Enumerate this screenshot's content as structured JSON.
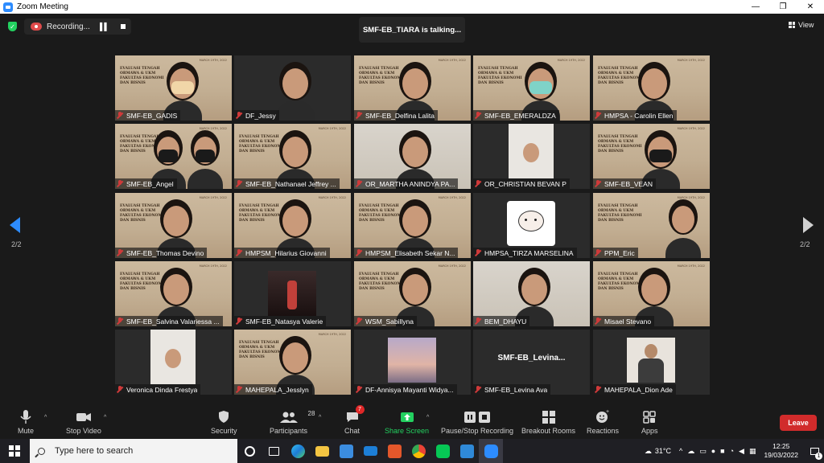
{
  "window": {
    "title": "Zoom Meeting",
    "minimize_glyph": "—",
    "maximize_glyph": "❐",
    "close_glyph": "✕"
  },
  "meeting": {
    "recording_label": "Recording...",
    "talking_indicator": "SMF-EB_TIARA is talking...",
    "view_label": "View",
    "page_left": "2/2",
    "page_right": "2/2",
    "poster_text": "EVALUASI TENGAH ORMAWA & UKM FAKULTAS EKONOMI DAN BISNIS",
    "poster_date": "MARCH 19TH, 2022",
    "participants": [
      {
        "name": "SMF-EB_GADIS"
      },
      {
        "name": "DF_Jessy"
      },
      {
        "name": "SMF-EB_Delfina Lalita"
      },
      {
        "name": "SMF-EB_EMERALDZA"
      },
      {
        "name": "HMPSA - Carolin Ellen"
      },
      {
        "name": "SMF-EB_Angel"
      },
      {
        "name": "SMF-EB_Nathanael Jeffrey ..."
      },
      {
        "name": "OR_MARTHA ANINDYA PA..."
      },
      {
        "name": "OR_CHRISTIAN BEVAN P"
      },
      {
        "name": "SMF-EB_VEAN"
      },
      {
        "name": "SMF-EB_Thomas Devino"
      },
      {
        "name": "HMPSM_Hilarius Giovanni"
      },
      {
        "name": "HMPSM_Elisabeth Sekar N..."
      },
      {
        "name": "HMPSA_TIRZA MARSELINA"
      },
      {
        "name": "PPM_Eric"
      },
      {
        "name": "SMF-EB_Salvina Valariessa ..."
      },
      {
        "name": "SMF-EB_Natasya Valerie"
      },
      {
        "name": "WSM_Sabillyna"
      },
      {
        "name": "BEM_DHAYU"
      },
      {
        "name": "Misael Stevano"
      },
      {
        "name": "Veronica Dinda Frestya"
      },
      {
        "name": "MAHEPALA_Jesslyn"
      },
      {
        "name": "DF-Annisya Mayanti Widya..."
      },
      {
        "name": "SMF-EB_Levina Ava",
        "big_label": "SMF-EB_Levina..."
      },
      {
        "name": "MAHEPALA_Dion Ade"
      }
    ]
  },
  "toolbar": {
    "mute": "Mute",
    "stop_video": "Stop Video",
    "security": "Security",
    "participants": "Participants",
    "participants_count": "28",
    "chat": "Chat",
    "chat_badge": "7",
    "share_screen": "Share Screen",
    "pause_stop_recording": "Pause/Stop Recording",
    "breakout_rooms": "Breakout Rooms",
    "reactions": "Reactions",
    "apps": "Apps",
    "leave": "Leave",
    "share_color": "#23d160",
    "leave_color": "#d12b2b"
  },
  "taskbar": {
    "search_placeholder": "Type here to search",
    "temperature": "31°C",
    "time": "12:25",
    "date": "19/03/2022",
    "notification_count": "1"
  }
}
